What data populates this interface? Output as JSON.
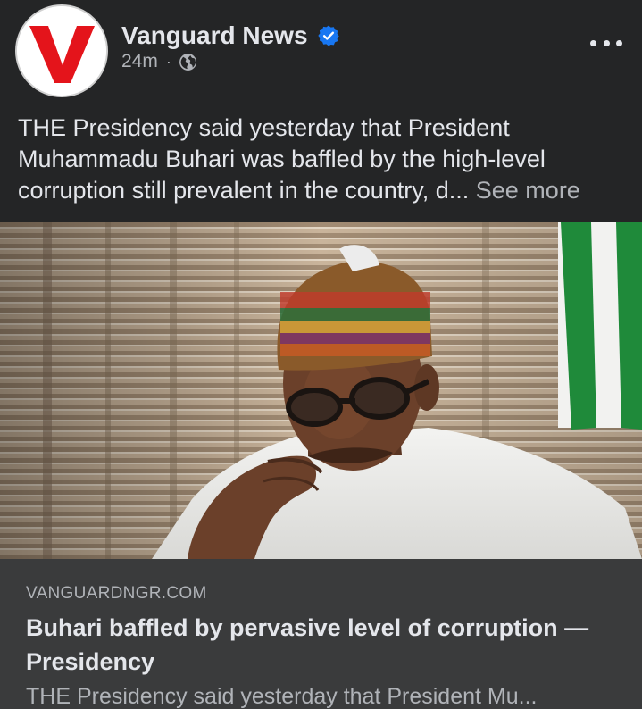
{
  "header": {
    "page_name": "Vanguard News",
    "time_ago": "24m",
    "separator": "·",
    "privacy_icon": "globe-icon",
    "verified_icon": "verified-badge-icon",
    "more_icon": "more-options-icon"
  },
  "post": {
    "text": "THE Presidency said yesterday that President Muhammadu Buhari was baffled by the high-level corruption still prevalent in the country, d...",
    "see_more_label": "See more"
  },
  "link_preview": {
    "domain": "VANGUARDNGR.COM",
    "title": "Buhari baffled by pervasive level of corruption — Presidency",
    "description": "THE Presidency said yesterday that President Mu..."
  },
  "colors": {
    "background": "#242526",
    "card_background": "#3a3b3c",
    "primary_text": "#e4e6eb",
    "secondary_text": "#b0b3b8",
    "verified_blue": "#1877f2",
    "logo_red": "#e4141b"
  }
}
